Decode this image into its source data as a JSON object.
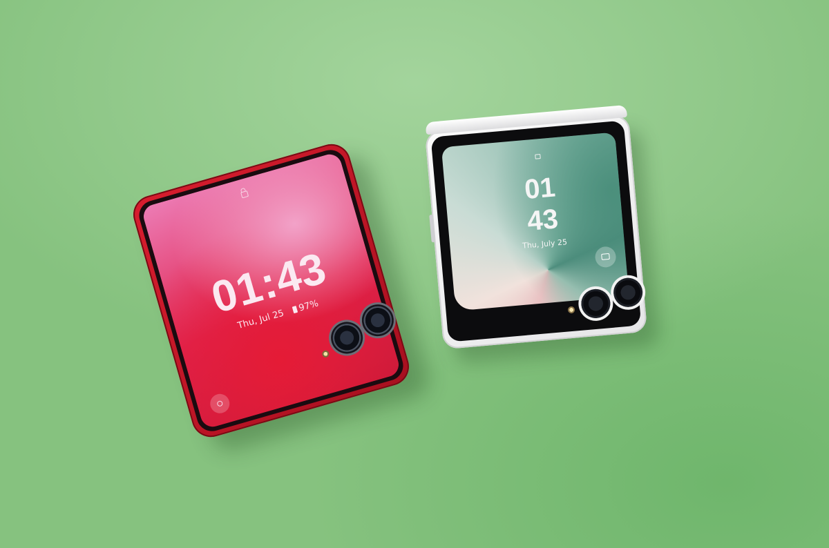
{
  "phone_left": {
    "lock_screen": {
      "time": "01:43",
      "date": "Thu, Jul 25",
      "battery": "97%"
    },
    "colors": {
      "body": "#d81d2e",
      "screen_accent": "#e0234e"
    }
  },
  "phone_right": {
    "lock_screen": {
      "hour": "01",
      "minute": "43",
      "date": "Thu, July 25"
    },
    "colors": {
      "body": "#f2f2f2",
      "screen_accent": "#4f8d7e"
    }
  },
  "background_color": "#86c27f",
  "icons": [
    "lock-icon",
    "battery-icon",
    "camera-shortcut-icon",
    "shortcut-icon"
  ]
}
